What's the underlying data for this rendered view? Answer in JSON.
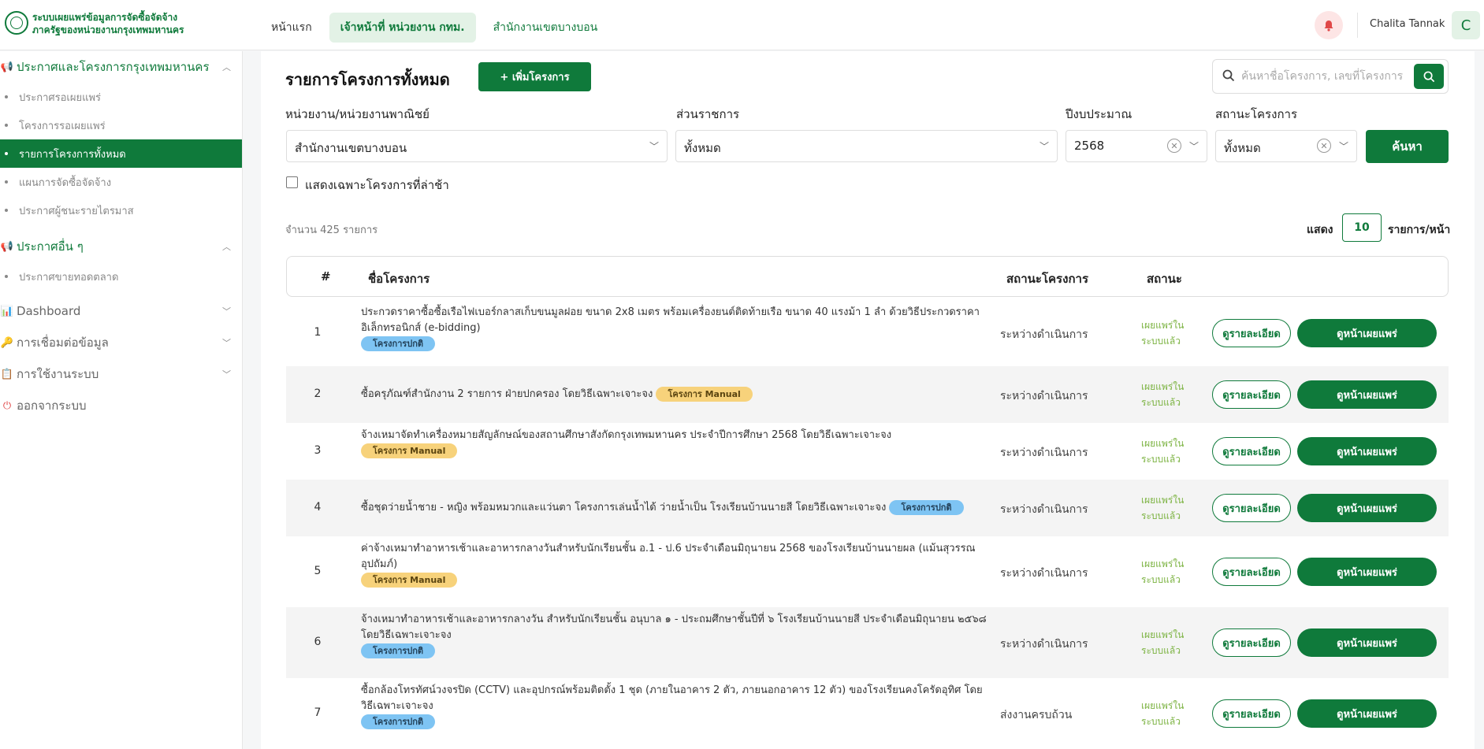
{
  "topbar": {
    "brand_line1": "ระบบเผยแพร่ข้อมูลการจัดซื้อจัดจ้าง",
    "brand_line2": "ภาครัฐของหน่วยงานกรุงเทพมหานคร",
    "nav": [
      "หน้าแรก",
      "เจ้าหน้าที่ หน่วยงาน กทม.",
      "สำนักงานเขตบางบอน"
    ],
    "username": "Chalita Tannak",
    "avatar_letter": "C"
  },
  "sidebar": {
    "section1": "ประกาศและโครงการกรุงเทพมหานคร",
    "section1_items": [
      "ประกาศรอเผยแพร่",
      "โครงการรอเผยแพร่",
      "รายการโครงการทั้งหมด",
      "แผนการจัดซื้อจัดจ้าง",
      "ประกาศผู้ชนะรายไตรมาส"
    ],
    "section2": "ประกาศอื่น ๆ",
    "section2_items": [
      "ประกาศขายทอดตลาด"
    ],
    "dashboard": "Dashboard",
    "connect": "การเชื่อมต่อข้อมูล",
    "usage": "การใช้งานระบบ",
    "logout": "ออกจากระบบ"
  },
  "main": {
    "title": "รายการโครงการทั้งหมด",
    "add_button": "+ เพิ่มโครงการ",
    "search_placeholder": "ค้นหาชื่อโครงการ, เลขที่โครงการ",
    "filters": {
      "agency_label": "หน่วยงาน/หน่วยงานพาณิชย์",
      "agency_value": "สำนักงานเขตบางบอน",
      "division_label": "ส่วนราชการ",
      "division_value": "ทั้งหมด",
      "year_label": "ปีงบประมาณ",
      "year_value": "2568",
      "status_label": "สถานะโครงการ",
      "status_value": "ทั้งหมด",
      "search_button": "ค้นหา"
    },
    "late_only_label": "แสดงเฉพาะโครงการที่ล่าช้า",
    "count_text": "จำนวน  425  รายการ",
    "show_label": "แสดง",
    "per_page": "10",
    "per_page_unit": "รายการ/หน้า"
  },
  "table": {
    "headers": [
      "#",
      "ชื่อโครงการ",
      "สถานะโครงการ",
      "สถานะ"
    ],
    "detail_button": "ดูรายละเอียด",
    "publish_button": "ดูหน้าเผยแพร่",
    "rows": [
      {
        "num": "1",
        "name": "ประกวดราคาซื้อซื้อเรือไฟเบอร์กลาสเก็บขนมูลฝอย ขนาด 2x8 เมตร พร้อมเครื่องยนต์ติดท้ายเรือ ขนาด 40 แรงม้า 1 ลำ ด้วยวิธีประกวดราคาอิเล็กทรอนิกส์ (e-bidding)",
        "tag": "โครงการปกติ",
        "tag_color": "blue",
        "project_status": "ระหว่างดำเนินการ",
        "status": "เผยแพร่ในระบบแล้ว"
      },
      {
        "num": "2",
        "name": "ซื้อครุภัณฑ์สำนักงาน 2 รายการ ฝ่ายปกครอง โดยวิธีเฉพาะเจาะจง",
        "tag": "โครงการ Manual",
        "tag_color": "yellow",
        "project_status": "ระหว่างดำเนินการ",
        "status": "เผยแพร่ในระบบแล้ว"
      },
      {
        "num": "3",
        "name": "จ้างเหมาจัดทำเครื่องหมายสัญลักษณ์ของสถานศึกษาสังกัดกรุงเทพมหานคร ประจำปีการศึกษา 2568 โดยวิธีเฉพาะเจาะจง",
        "tag": "โครงการ Manual",
        "tag_color": "yellow",
        "project_status": "ระหว่างดำเนินการ",
        "status": "เผยแพร่ในระบบแล้ว"
      },
      {
        "num": "4",
        "name": "ซื้อชุดว่ายน้ำชาย - หญิง พร้อมหมวกและแว่นตา โครงการเล่นน้ำได้ ว่ายน้ำเป็น โรงเรียนบ้านนายสี โดยวิธีเฉพาะเจาะจง",
        "tag": "โครงการปกติ",
        "tag_color": "blue",
        "project_status": "ระหว่างดำเนินการ",
        "status": "เผยแพร่ในระบบแล้ว"
      },
      {
        "num": "5",
        "name": "ค่าจ้างเหมาทำอาหารเช้าและอาหารกลางวันสำหรับนักเรียนชั้น อ.1 - ป.6 ประจำเดือนมิถุนายน 2568 ของโรงเรียนบ้านนายผล (แม้นสุวรรณอุปถัมภ์)",
        "tag": "โครงการ Manual",
        "tag_color": "yellow",
        "project_status": "ระหว่างดำเนินการ",
        "status": "เผยแพร่ในระบบแล้ว"
      },
      {
        "num": "6",
        "name": "จ้างเหมาทำอาหารเช้าและอาหารกลางวัน สำหรับนักเรียนชั้น อนุบาล ๑ - ประถมศึกษาชั้นปีที่ ๖ โรงเรียนบ้านนายสี ประจำเดือนมิถุนายน ๒๕๖๘ โดยวิธีเฉพาะเจาะจง",
        "tag": "โครงการปกติ",
        "tag_color": "blue",
        "project_status": "ระหว่างดำเนินการ",
        "status": "เผยแพร่ในระบบแล้ว"
      },
      {
        "num": "7",
        "name": "ซื้อกล้องโทรทัศน์วงจรปิด (CCTV) และอุปกรณ์พร้อมติดตั้ง 1 ชุด (ภายในอาคาร 2 ตัว, ภายนอกอาคาร 12 ตัว) ของโรงเรียนคงโครัดอุทิศ โดยวิธีเฉพาะเจาะจง",
        "tag": "โครงการปกติ",
        "tag_color": "blue",
        "project_status": "ส่งงานครบถ้วน",
        "status": "เผยแพร่ในระบบแล้ว"
      }
    ]
  },
  "colors": {
    "primary": "#0f7a3b",
    "status_green": "#7cb342",
    "tag_blue": "#7ec4f3",
    "tag_yellow": "#f7d27b"
  },
  "icons": [
    "seal-logo-icon",
    "bell-icon",
    "megaphone-icon",
    "chart-icon",
    "key-icon",
    "clipboard-icon",
    "logout-icon",
    "search-icon",
    "chevron-down-icon",
    "clear-icon"
  ]
}
